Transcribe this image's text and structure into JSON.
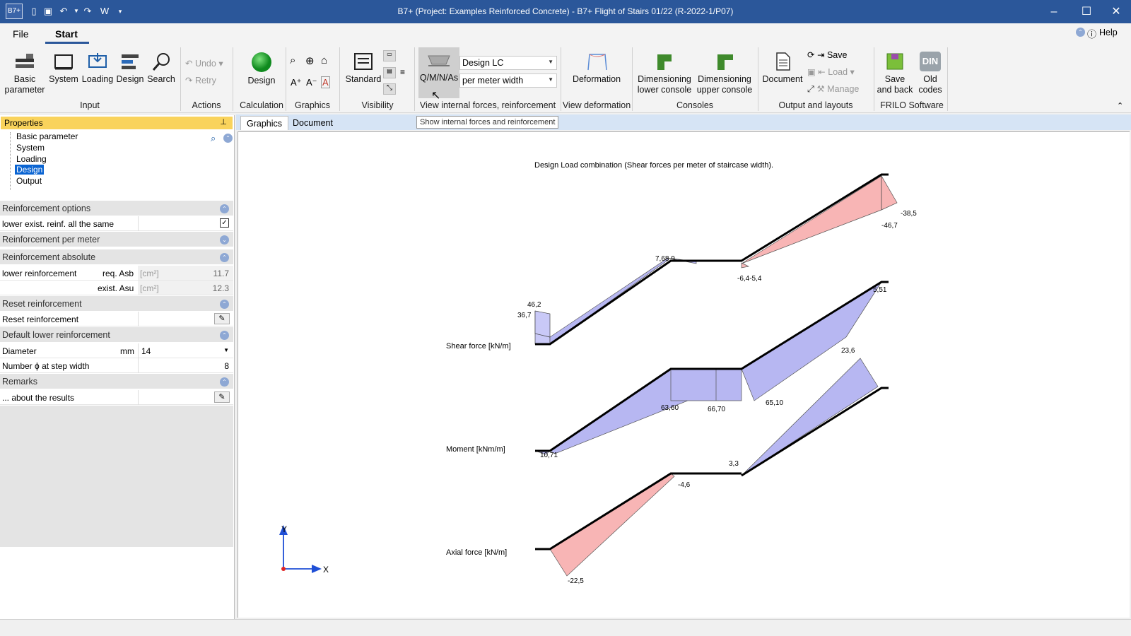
{
  "window": {
    "title": "B7+ (Project: Examples Reinforced Concrete) - B7+ Flight of Stairs 01/22 (R-2022-1/P07)",
    "logo": "B7+"
  },
  "menu": {
    "file": "File",
    "start": "Start",
    "help": "Help"
  },
  "ribbon": {
    "input": {
      "basic_parameter": "Basic parameter",
      "system": "System",
      "loading": "Loading",
      "design": "Design",
      "search": "Search",
      "group": "Input"
    },
    "actions": {
      "undo": "Undo",
      "retry": "Retry",
      "group": "Actions"
    },
    "calculation": {
      "design": "Design",
      "group": "Calculation"
    },
    "graphics": {
      "group": "Graphics"
    },
    "visibility": {
      "standard": "Standard",
      "group": "Visibility"
    },
    "internal_forces": {
      "qmnas": "Q/M/N/As",
      "lc_select": "Design LC",
      "width_select": "per meter width",
      "group": "View internal forces, reinforcement"
    },
    "deformation": {
      "label": "Deformation",
      "group": "View deformation"
    },
    "consoles": {
      "lower": "Dimensioning lower console",
      "upper": "Dimensioning upper console",
      "group": "Consoles"
    },
    "output": {
      "document": "Document",
      "save": "Save",
      "load": "Load",
      "manage": "Manage",
      "group": "Output and layouts"
    },
    "frilo": {
      "save_back": "Save and back",
      "old_codes": "Old codes",
      "din": "DIN",
      "group": "FRILO Software"
    }
  },
  "properties": {
    "header": "Properties",
    "tree": [
      "Basic parameter",
      "System",
      "Loading",
      "Design",
      "Output"
    ],
    "selected_tree_item": "Design",
    "sections": {
      "reinf_options": "Reinforcement options",
      "lower_same": "lower exist. reinf. all the same",
      "reinf_per_meter": "Reinforcement per meter",
      "reinf_absolute": "Reinforcement absolute",
      "lower_reinf": "lower reinforcement",
      "req_asb": "req. Asb",
      "exist_asu": "exist. Asu",
      "unit_cm2": "[cm²]",
      "req_asb_val": "11.7",
      "exist_asu_val": "12.3",
      "reset_sec": "Reset reinforcement",
      "reset_row": "Reset reinforcement",
      "default_lower": "Default lower reinforcement",
      "diameter": "Diameter",
      "mm": "mm",
      "diameter_val": "14",
      "number_step": "Number ϕ at step width",
      "number_step_val": "8",
      "remarks": "Remarks",
      "about_results": "... about the results"
    }
  },
  "doc_tabs": {
    "graphics": "Graphics",
    "document": "Document"
  },
  "tooltip": "Show internal forces and reinforcement",
  "diagram": {
    "title": "Design Load combination (Shear forces per meter of staircase width).",
    "shear_label": "Shear force [kN/m]",
    "moment_label": "Moment [kNm/m]",
    "axial_label": "Axial force [kN/m]",
    "shear_values": [
      "46,2",
      "36,7",
      "7,68,9",
      "-6,4-5,4",
      "-38,5",
      "-46,7"
    ],
    "moment_values": [
      "5,51",
      "23,6",
      "63,60",
      "66,70",
      "65,10",
      "10,71"
    ],
    "axial_values": [
      "3,3",
      "-4,6",
      "-22,5"
    ],
    "axis_x": "X",
    "axis_y": "Y"
  }
}
